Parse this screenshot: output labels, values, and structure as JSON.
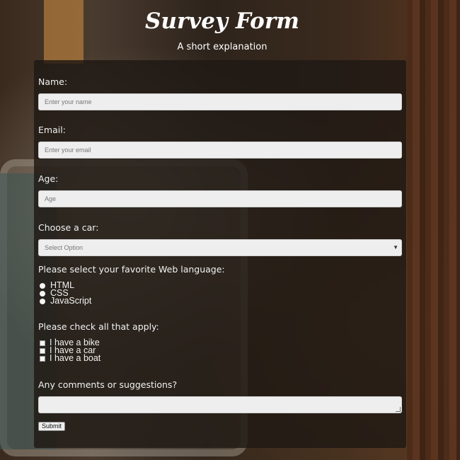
{
  "header": {
    "title": "Survey Form",
    "subtitle": "A short explanation"
  },
  "form": {
    "name": {
      "label": "Name:",
      "placeholder": "Enter your name"
    },
    "email": {
      "label": "Email:",
      "placeholder": "Enter your email"
    },
    "age": {
      "label": "Age:",
      "placeholder": "Age"
    },
    "car": {
      "label": "Choose a car:",
      "selected": "Select Option"
    },
    "language": {
      "label": "Please select your favorite Web language:",
      "options": [
        "HTML",
        "CSS",
        "JavaScript"
      ]
    },
    "check": {
      "label": "Please check all that apply:",
      "options": [
        "I have a bike",
        "I have a car",
        "I have a boat"
      ]
    },
    "comments": {
      "label": "Any comments or suggestions?"
    },
    "submit_label": "Submit"
  }
}
